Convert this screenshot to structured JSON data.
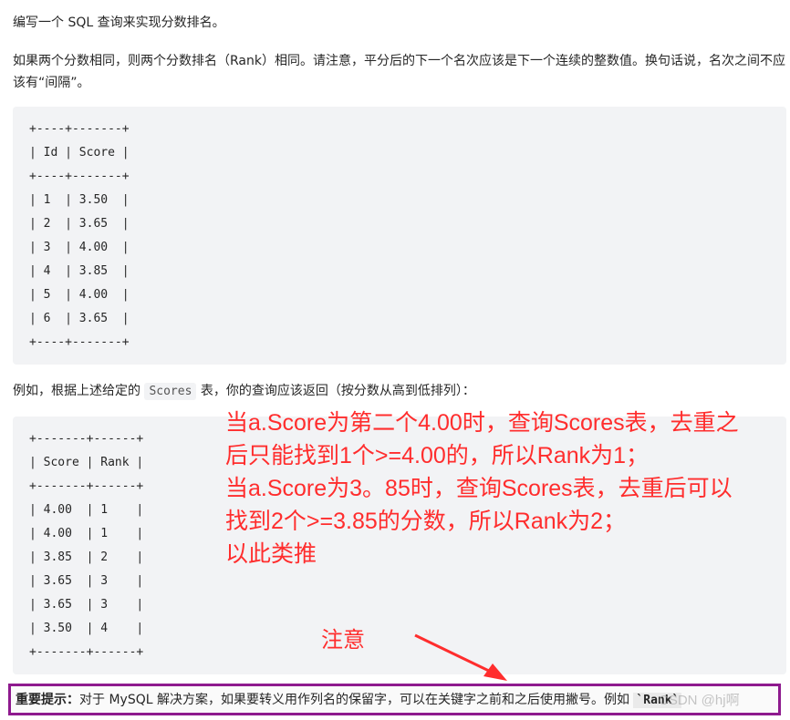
{
  "intro": {
    "line1": "编写一个 SQL 查询来实现分数排名。",
    "line2": "如果两个分数相同，则两个分数排名（Rank）相同。请注意，平分后的下一个名次应该是下一个连续的整数值。换句话说，名次之间不应该有“间隔”。"
  },
  "scores_table": "+----+-------+\n| Id | Score |\n+----+-------+\n| 1  | 3.50  |\n| 2  | 3.65  |\n| 3  | 4.00  |\n| 4  | 3.85  |\n| 5  | 4.00  |\n| 6  | 3.65  |\n+----+-------+",
  "example": {
    "prefix": "例如，根据上述给定的 ",
    "code": "Scores",
    "suffix": " 表，你的查询应该返回（按分数从高到低排列）："
  },
  "result_table": "+-------+------+\n| Score | Rank |\n+-------+------+\n| 4.00  | 1    |\n| 4.00  | 1    |\n| 3.85  | 2    |\n| 3.65  | 3    |\n| 3.65  | 3    |\n| 3.50  | 4    |\n+-------+------+",
  "annotation": {
    "line1": "当a.Score为第二个4.00时，查询Scores表，去重之",
    "line2": "后只能找到1个>=4.00的，所以Rank为1；",
    "line3": "当a.Score为3。85时，查询Scores表，去重后可以",
    "line4": "找到2个>=3.85的分数，所以Rank为2；",
    "line5": "以此类推",
    "note": "注意",
    "color": "#ff2d2d"
  },
  "tip": {
    "label": "重要提示：",
    "text": "对于 MySQL 解决方案，如果要转义用作列名的保留字，可以在关键字之前和之后使用撇号。例如 ",
    "code": "`Rank`",
    "border_color": "#8e1a8e"
  },
  "watermark": "CSDN @hj啊"
}
